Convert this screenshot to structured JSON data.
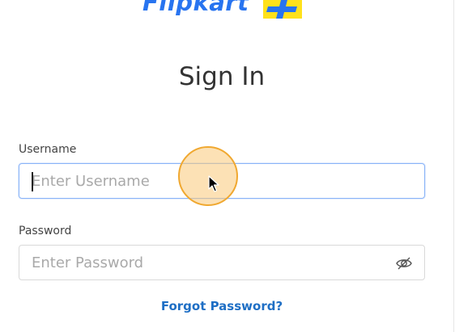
{
  "brand": {
    "logo_text": "Flipkart",
    "logo_color": "#2874f0",
    "badge_color": "#ffe11b"
  },
  "page": {
    "title": "Sign In"
  },
  "form": {
    "username": {
      "label": "Username",
      "placeholder": "Enter Username",
      "value": ""
    },
    "password": {
      "label": "Password",
      "placeholder": "Enter Password",
      "value": "",
      "toggle_icon": "eye-slash-icon"
    },
    "forgot_password_label": "Forgot Password?"
  },
  "colors": {
    "link": "#1f6fc5",
    "focus_border": "#8ab4f8",
    "border": "#d9d9d9"
  }
}
